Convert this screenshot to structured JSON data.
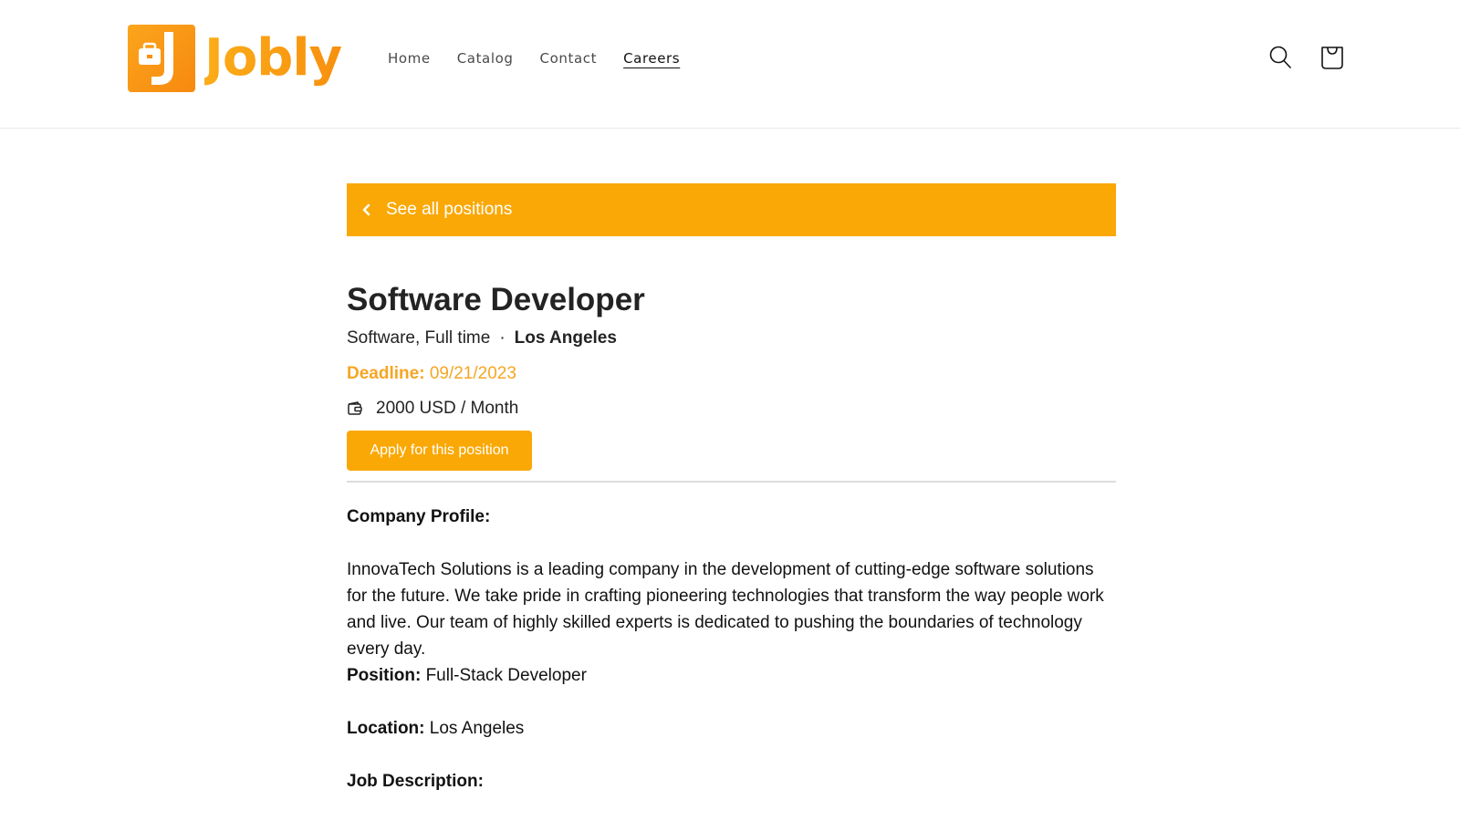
{
  "header": {
    "logo_text": "Jobly",
    "nav": [
      {
        "label": "Home",
        "active": false
      },
      {
        "label": "Catalog",
        "active": false
      },
      {
        "label": "Contact",
        "active": false
      },
      {
        "label": "Careers",
        "active": true
      }
    ],
    "icons": [
      "search-icon",
      "cart-icon"
    ]
  },
  "job": {
    "back_label": "See all positions",
    "title": "Software Developer",
    "categories": "Software, Full time",
    "separator": "·",
    "city": "Los Angeles",
    "deadline_label": "Deadline:",
    "deadline_value": "09/21/2023",
    "salary": "2000 USD / Month",
    "apply_label": "Apply for this position"
  },
  "description": {
    "company_heading": "Company Profile:",
    "company_text": "InnovaTech Solutions is a leading company in the development of cutting-edge software solutions for the future. We take pride in crafting pioneering technologies that transform the way people work and live. Our team of highly skilled experts is dedicated to pushing the boundaries of technology every day.",
    "position_label": "Position:",
    "position_value": "Full-Stack Developer",
    "location_label": "Location:",
    "location_value": "Los Angeles",
    "job_description_heading": "Job Description:"
  },
  "colors": {
    "accent": "#faa805",
    "deadline": "#f5a623",
    "text": "#232323"
  }
}
